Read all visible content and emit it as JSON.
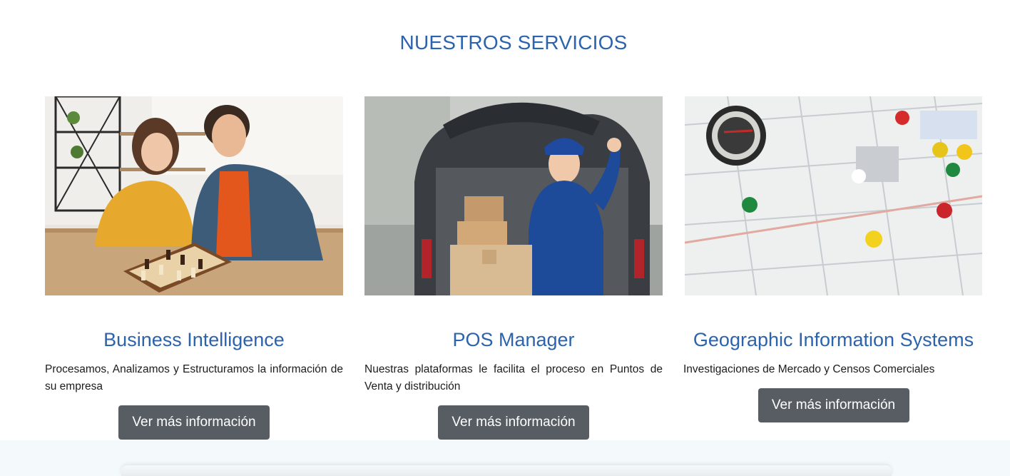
{
  "section": {
    "title": "NUESTROS SERVICIOS"
  },
  "services": [
    {
      "title": "Business Intelligence",
      "description": "Procesamos, Analizamos y Estructuramos la información de su empresa",
      "button": "Ver más información"
    },
    {
      "title": "POS Manager",
      "description": "Nuestras plataformas le facilita el proceso en Puntos de Venta y distribución",
      "button": "Ver más información"
    },
    {
      "title": "Geographic Information Systems",
      "description": "Investigaciones de Mercado y Censos Comerciales",
      "button": "Ver más información"
    }
  ],
  "colors": {
    "accent": "#2b63ad",
    "button_bg": "#575d63",
    "button_text": "#ffffff"
  }
}
